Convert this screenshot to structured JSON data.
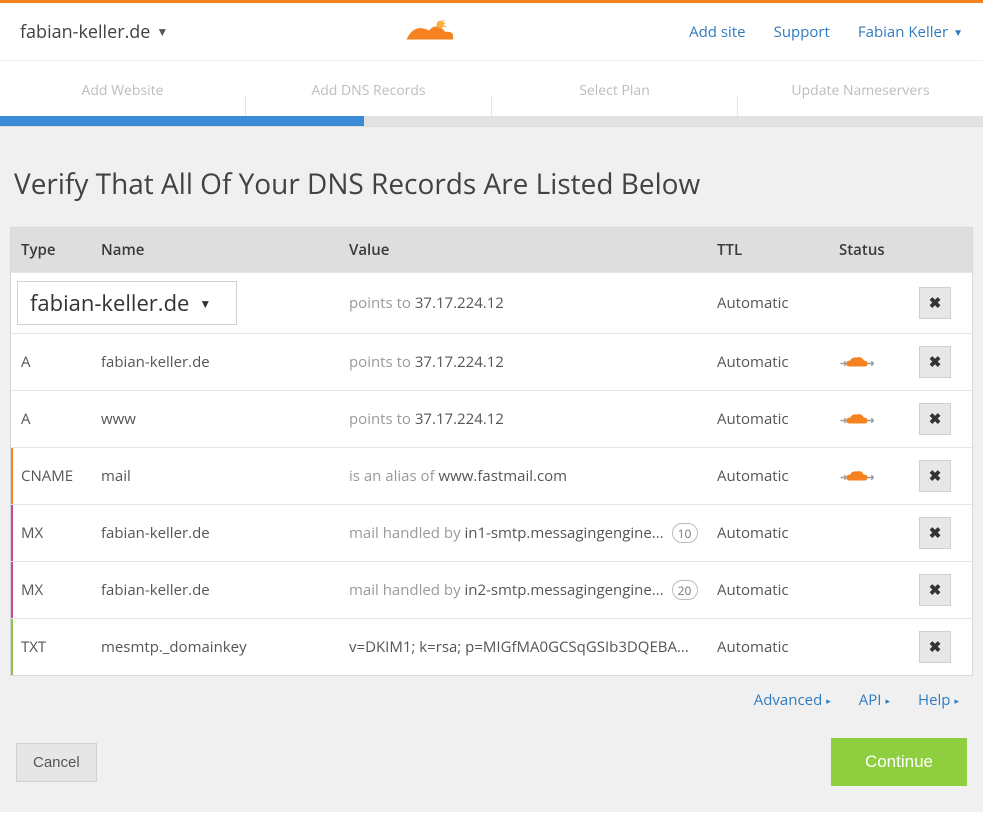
{
  "header": {
    "site": "fabian-keller.de",
    "add_site": "Add site",
    "support": "Support",
    "user": "Fabian Keller"
  },
  "wizard": {
    "steps": [
      "Add Website",
      "Add DNS Records",
      "Select Plan",
      "Update Nameservers"
    ]
  },
  "page_title": "Verify That All Of Your DNS Records Are Listed Below",
  "columns": {
    "type": "Type",
    "name": "Name",
    "value": "Value",
    "ttl": "TTL",
    "status": "Status"
  },
  "domain_select": "fabian-keller.de",
  "first_row": {
    "value_prefix": "points to ",
    "value": "37.17.224.12",
    "ttl": "Automatic"
  },
  "records": [
    {
      "type": "A",
      "type_class": "",
      "stripe": "",
      "name": "fabian-keller.de",
      "value_prefix": "points to ",
      "value": "37.17.224.12",
      "priority": "",
      "ttl": "Automatic",
      "cloud": true
    },
    {
      "type": "A",
      "type_class": "",
      "stripe": "",
      "name": "www",
      "value_prefix": "points to ",
      "value": "37.17.224.12",
      "priority": "",
      "ttl": "Automatic",
      "cloud": true
    },
    {
      "type": "CNAME",
      "type_class": "type-cname",
      "stripe": "orange",
      "name": "mail",
      "value_prefix": "is an alias of ",
      "value": "www.fastmail.com",
      "priority": "",
      "ttl": "Automatic",
      "cloud": true
    },
    {
      "type": "MX",
      "type_class": "type-mx",
      "stripe": "magenta",
      "name": "fabian-keller.de",
      "value_prefix": "mail handled by ",
      "value": "in1-smtp.messagingengine...",
      "priority": "10",
      "ttl": "Automatic",
      "cloud": false
    },
    {
      "type": "MX",
      "type_class": "type-mx",
      "stripe": "magenta",
      "name": "fabian-keller.de",
      "value_prefix": "mail handled by ",
      "value": "in2-smtp.messagingengine...",
      "priority": "20",
      "ttl": "Automatic",
      "cloud": false
    },
    {
      "type": "TXT",
      "type_class": "type-txt",
      "stripe": "green",
      "name": "mesmtp._domainkey",
      "value_prefix": "",
      "value": "v=DKIM1; k=rsa; p=MIGfMA0GCSqGSIb3DQEBA...",
      "priority": "",
      "ttl": "Automatic",
      "cloud": false
    }
  ],
  "footer_links": {
    "advanced": "Advanced",
    "api": "API",
    "help": "Help"
  },
  "buttons": {
    "cancel": "Cancel",
    "continue": "Continue"
  }
}
